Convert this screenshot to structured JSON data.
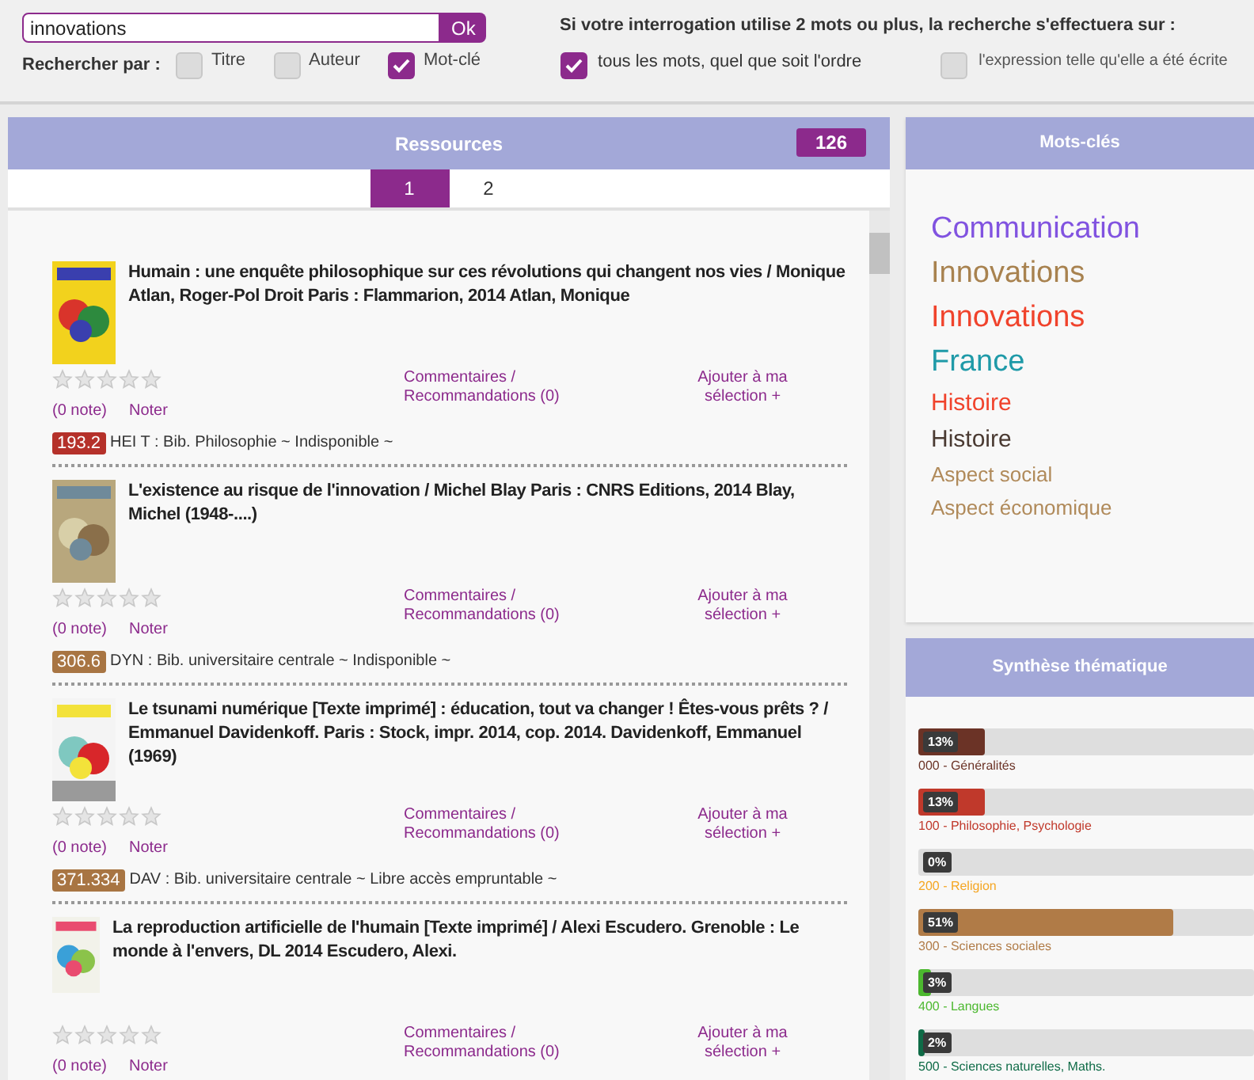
{
  "search": {
    "value": "innovations",
    "button": "Ok",
    "by_label": "Rechercher par :",
    "fields": [
      {
        "label": "Titre",
        "checked": false
      },
      {
        "label": "Auteur",
        "checked": false
      },
      {
        "label": "Mot-clé",
        "checked": true
      }
    ]
  },
  "mode": {
    "title": "Si votre interrogation utilise 2 mots ou plus, la recherche s'effectuera sur :",
    "options": [
      {
        "label": "tous les mots, quel que soit l'ordre",
        "checked": true
      },
      {
        "label": "l'expression telle qu'elle a été écrite",
        "checked": false
      }
    ]
  },
  "resources": {
    "title": "Ressources",
    "count": "126",
    "pages": [
      {
        "label": "1",
        "selected": true
      },
      {
        "label": "2",
        "selected": false
      }
    ],
    "items": [
      {
        "title": "Humain : une enquête philosophique sur ces révolutions qui changent nos vies / Monique Atlan, Roger-Pol Droit Paris : Flammarion, 2014 Atlan, Monique",
        "stars": 0,
        "notes": "(0 note)",
        "rate": "Noter",
        "comments": "Commentaires / Recommandations (0)",
        "add": "Ajouter à ma sélection +",
        "call_number": "193.2",
        "color": "#b5312a",
        "location": "HEI T : Bib. Philosophie ~ Indisponible ~"
      },
      {
        "title": "L'existence au risque de l'innovation / Michel Blay Paris : CNRS Editions, 2014 Blay, Michel (1948-....)",
        "stars": 0,
        "notes": "(0 note)",
        "rate": "Noter",
        "comments": "Commentaires / Recommandations (0)",
        "add": "Ajouter à ma sélection +",
        "call_number": "306.6",
        "color": "#a87543",
        "location": "DYN : Bib. universitaire centrale ~ Indisponible ~"
      },
      {
        "title": "Le tsunami numérique [Texte imprimé] : éducation, tout va changer ! Êtes-vous prêts ? / Emmanuel Davidenkoff. Paris : Stock, impr. 2014, cop. 2014. Davidenkoff, Emmanuel (1969)",
        "stars": 0,
        "notes": "(0 note)",
        "rate": "Noter",
        "comments": "Commentaires / Recommandations (0)",
        "add": "Ajouter à ma sélection +",
        "call_number": "371.334",
        "color": "#a87543",
        "location": "DAV : Bib. universitaire centrale ~ Libre accès empruntable ~"
      },
      {
        "title": "La reproduction artificielle de l'humain [Texte imprimé] / Alexi Escudero. Grenoble : Le monde à l'envers, DL 2014 Escudero, Alexi.",
        "stars": 0,
        "notes": "(0 note)",
        "rate": "Noter",
        "comments": "Commentaires / Recommandations (0)",
        "add": "Ajouter à ma sélection +"
      }
    ]
  },
  "keywords": {
    "title": "Mots-clés",
    "items": [
      {
        "label": "Communication",
        "kind": "large",
        "color": "#8153e0"
      },
      {
        "label": "Innovations",
        "kind": "large",
        "color": "#a8824f"
      },
      {
        "label": "Innovations",
        "kind": "large",
        "color": "#f0432c"
      },
      {
        "label": "France",
        "kind": "large",
        "color": "#1f9aa8"
      },
      {
        "label": "Histoire",
        "kind": "medium",
        "color": "#f0432c"
      },
      {
        "label": "Histoire",
        "kind": "medium",
        "color": "#4a3a32"
      },
      {
        "label": "Aspect social",
        "kind": "small",
        "color": "#b08a5a"
      },
      {
        "label": "Aspect économique",
        "kind": "small",
        "color": "#b08a5a"
      }
    ]
  },
  "synthesis": {
    "title": "Synthèse thématique",
    "items": [
      {
        "percent": "13%",
        "level": 0.2,
        "color": "#6b3326",
        "label": "000 - Généralités"
      },
      {
        "percent": "13%",
        "level": 0.2,
        "color": "#c0392b",
        "label": "100 - Philosophie, Psychologie"
      },
      {
        "percent": "0%",
        "level": 0,
        "color": "#f5a623",
        "label": "200 - Religion"
      },
      {
        "percent": "51%",
        "level": 0.76,
        "color": "#b07b47",
        "label": "300 - Sciences sociales"
      },
      {
        "percent": "3%",
        "level": 0.04,
        "color": "#4cb82f",
        "label": "400 - Langues"
      },
      {
        "percent": "2%",
        "level": 0.02,
        "color": "#0f6b47",
        "label": "500 - Sciences naturelles, Maths."
      }
    ]
  }
}
